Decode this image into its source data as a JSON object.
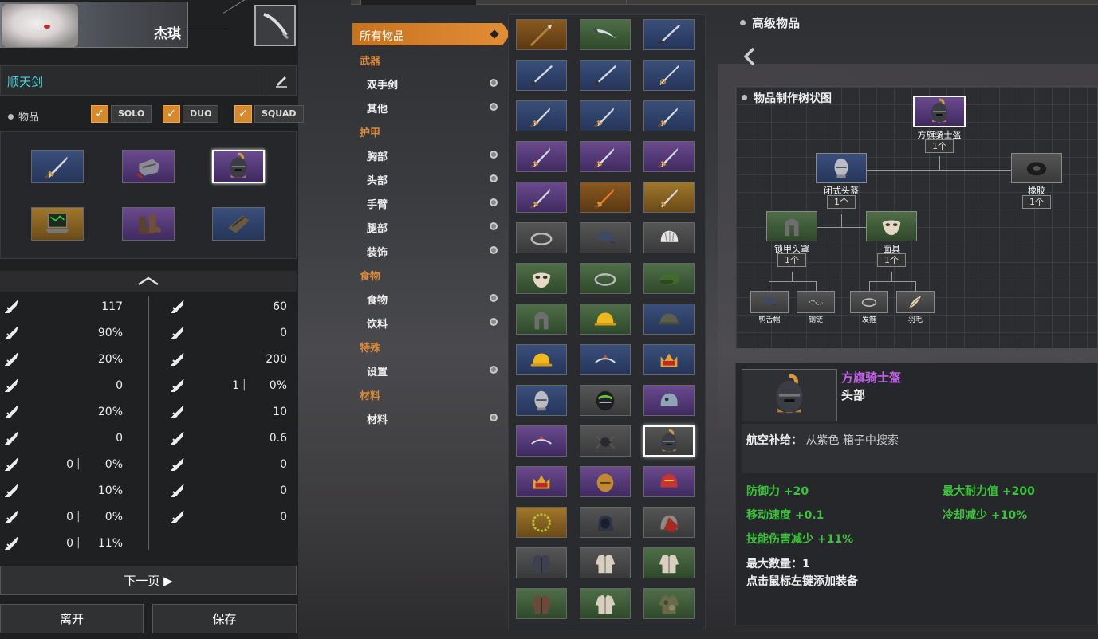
{
  "player": {
    "name": "杰琪"
  },
  "loadout": {
    "name": "顺天剑"
  },
  "items_filter": {
    "label": "物品",
    "modes": [
      {
        "label": "SOLO",
        "checked": true
      },
      {
        "label": "DUO",
        "checked": true
      },
      {
        "label": "SQUAD",
        "checked": true
      }
    ]
  },
  "equip_slots": [
    {
      "icon": "sword-icon",
      "quality": "blue"
    },
    {
      "icon": "gauntlet-icon",
      "quality": "purple"
    },
    {
      "icon": "knight-helmet-icon",
      "quality": "purple",
      "selected": true
    },
    {
      "icon": "laptop-icon",
      "quality": "gold"
    },
    {
      "icon": "boots-icon",
      "quality": "purple"
    },
    {
      "icon": "arm-guard-icon",
      "quality": "blue"
    }
  ],
  "stats_left": [
    {
      "icon": "attack-icon",
      "value": "117"
    },
    {
      "icon": "attack-speed-icon",
      "value": "90%"
    },
    {
      "icon": "crit-rate-icon",
      "value": "20%"
    },
    {
      "icon": "crit-damage-icon",
      "value": "0"
    },
    {
      "icon": "lifesteal-icon",
      "value": "20%"
    },
    {
      "icon": "penetration-icon",
      "value": "0"
    },
    {
      "icon": "skill-amp-icon",
      "value": "0",
      "value2": "0%"
    },
    {
      "icon": "cooldown-icon",
      "value": "10%"
    },
    {
      "icon": "skill-damage-icon",
      "value": "0",
      "value2": "0%"
    },
    {
      "icon": "splash-icon",
      "value": "0",
      "value2": "11%"
    }
  ],
  "stats_right": [
    {
      "icon": "defense-icon",
      "value": "60"
    },
    {
      "icon": "hp-regen-icon",
      "value": "0"
    },
    {
      "icon": "max-hp-icon",
      "value": "200"
    },
    {
      "icon": "heal-icon",
      "value": "1",
      "value2": "0%"
    },
    {
      "icon": "stamina-icon",
      "value": "10"
    },
    {
      "icon": "tenacity-icon",
      "value": "0.6"
    },
    {
      "icon": "move-speed-icon",
      "value": "0"
    },
    {
      "icon": "vision-icon",
      "value": "0"
    },
    {
      "icon": "range-icon",
      "value": "0"
    }
  ],
  "buttons": {
    "next": "下一页 ▶",
    "leave": "离开",
    "save": "保存"
  },
  "categories": {
    "all": "所有物品",
    "groups": [
      {
        "header": "武器",
        "items": [
          "双手剑",
          "其他"
        ]
      },
      {
        "header": "护甲",
        "items": [
          "胸部",
          "头部",
          "手臂",
          "腿部",
          "装饰"
        ]
      },
      {
        "header": "食物",
        "items": [
          "食物",
          "饮料"
        ]
      },
      {
        "header": "特殊",
        "items": [
          "设置"
        ]
      },
      {
        "header": "材料",
        "items": [
          "材料"
        ]
      }
    ]
  },
  "item_grid": [
    {
      "q": "orange",
      "icon": "spear-icon"
    },
    {
      "q": "green",
      "icon": "scimitar-icon"
    },
    {
      "q": "blue",
      "icon": "katana-icon"
    },
    {
      "q": "blue",
      "icon": "katana-icon"
    },
    {
      "q": "blue",
      "icon": "katana-icon"
    },
    {
      "q": "blue",
      "icon": "rapier-icon"
    },
    {
      "q": "blue",
      "icon": "sword-icon"
    },
    {
      "q": "blue",
      "icon": "sword-icon"
    },
    {
      "q": "blue",
      "icon": "sword-icon"
    },
    {
      "q": "purple",
      "icon": "sword-icon"
    },
    {
      "q": "purple",
      "icon": "sword-icon"
    },
    {
      "q": "purple",
      "icon": "sword-icon"
    },
    {
      "q": "purple",
      "icon": "sword-icon"
    },
    {
      "q": "orange",
      "icon": "fire-sword-icon"
    },
    {
      "q": "gold",
      "icon": "sword-icon"
    },
    {
      "q": "gray",
      "icon": "circlet-icon"
    },
    {
      "q": "gray",
      "icon": "cap-icon"
    },
    {
      "q": "gray",
      "icon": "bike-helmet-icon"
    },
    {
      "q": "green",
      "icon": "mask-icon"
    },
    {
      "q": "green",
      "icon": "circlet-icon"
    },
    {
      "q": "green",
      "icon": "beret-icon"
    },
    {
      "q": "green",
      "icon": "chain-hood-icon"
    },
    {
      "q": "green",
      "icon": "hard-hat-icon"
    },
    {
      "q": "blue",
      "icon": "army-helmet-icon"
    },
    {
      "q": "blue",
      "icon": "hard-hat-icon"
    },
    {
      "q": "blue",
      "icon": "tiara-icon"
    },
    {
      "q": "blue",
      "icon": "crown-icon"
    },
    {
      "q": "blue",
      "icon": "closed-helm-icon"
    },
    {
      "q": "gray",
      "icon": "moto-helmet-icon"
    },
    {
      "q": "purple",
      "icon": "fish-helm-icon"
    },
    {
      "q": "purple",
      "icon": "tiara-icon"
    },
    {
      "q": "gray",
      "icon": "spider-icon"
    },
    {
      "q": "gray",
      "icon": "knight-helmet-icon",
      "selected": true
    },
    {
      "q": "purple",
      "icon": "crown-icon"
    },
    {
      "q": "purple",
      "icon": "gold-helmet-icon"
    },
    {
      "q": "purple",
      "icon": "dragon-helm-icon"
    },
    {
      "q": "gold",
      "icon": "laurel-icon"
    },
    {
      "q": "gray",
      "icon": "hood-icon"
    },
    {
      "q": "gray",
      "icon": "red-helm-icon"
    },
    {
      "q": "gray",
      "icon": "jacket-icon"
    },
    {
      "q": "gray",
      "icon": "shirt-icon"
    },
    {
      "q": "green",
      "icon": "shirt-icon"
    },
    {
      "q": "green",
      "icon": "leather-jacket-icon"
    },
    {
      "q": "green",
      "icon": "vest-icon"
    },
    {
      "q": "green",
      "icon": "camo-icon"
    }
  ],
  "right": {
    "section_title": "高级物品",
    "tree_title": "物品制作树状图",
    "tree": {
      "root": {
        "name": "方旗骑士盔",
        "count": "1个",
        "icon": "knight-helmet-icon"
      },
      "lvl1": [
        {
          "name": "闭式头盔",
          "count": "1个",
          "icon": "closed-helm-icon"
        },
        {
          "name": "橡胶",
          "count": "1个",
          "icon": "rubber-icon"
        }
      ],
      "lvl2": [
        {
          "name": "锁甲头罩",
          "count": "1个",
          "icon": "chain-hood-icon"
        },
        {
          "name": "面具",
          "count": "1个",
          "icon": "mask-icon"
        }
      ],
      "lvl3": [
        {
          "name": "鸭舌帽",
          "icon": "cap-icon"
        },
        {
          "name": "钢链",
          "icon": "chain-icon"
        },
        {
          "name": "发箍",
          "icon": "circlet-icon"
        },
        {
          "name": "羽毛",
          "icon": "feather-icon"
        }
      ]
    },
    "detail": {
      "name": "方旗骑士盔",
      "type": "头部",
      "source_label": "航空补给：",
      "source_value": "从紫色 箱子中搜索",
      "stats": [
        {
          "text": "防御力 +20"
        },
        {
          "text": "最大耐力值 +200"
        },
        {
          "text": "移动速度 +0.1"
        },
        {
          "text": "冷却减少 +10%"
        },
        {
          "text": "技能伤害减少 +11%"
        }
      ],
      "max_count": "最大数量：1",
      "hint": "点击鼠标左键添加装备"
    }
  },
  "colors": {
    "accent": "#e08c35",
    "name_cyan": "#4fd1d9",
    "rare_purple": "#c162e8",
    "stat_green": "#3bc43b"
  }
}
